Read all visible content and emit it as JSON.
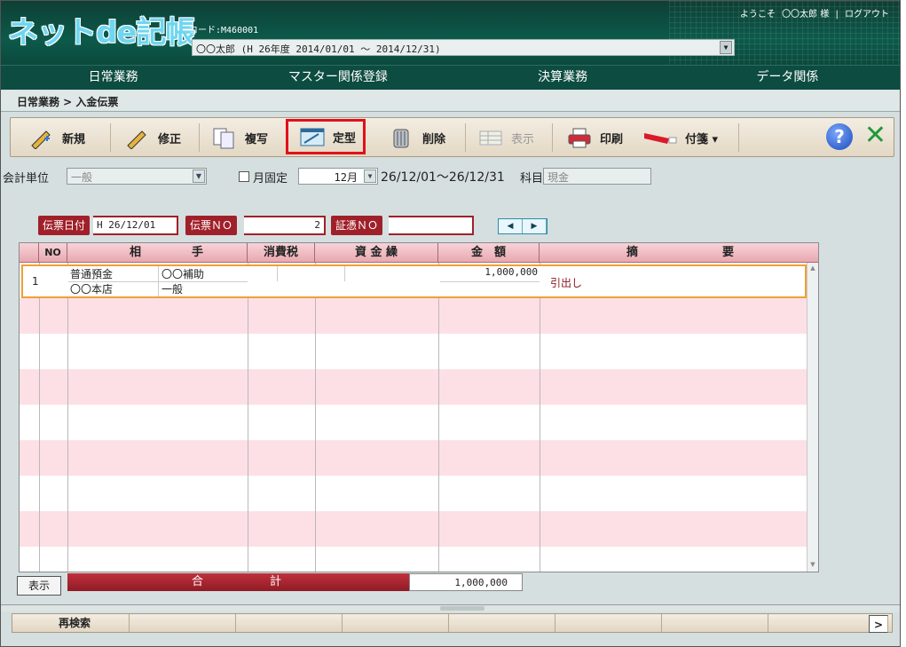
{
  "header": {
    "logo_main": "ネットde記帳",
    "code": "コード:M460001",
    "company": "〇〇太郎 (H 26年度 2014/01/01 ～ 2014/12/31)",
    "welcome": "ようこそ",
    "user": "〇〇太郎 様",
    "separator": "|",
    "logout": "ログアウト"
  },
  "menu": [
    "日常業務",
    "マスター関係登録",
    "決算業務",
    "データ関係"
  ],
  "breadcrumb": "日常業務 > 入金伝票",
  "toolbar": {
    "new": "新規",
    "edit": "修正",
    "copy": "複写",
    "template": "定型",
    "delete": "削除",
    "display": "表示",
    "print": "印刷",
    "sticky": "付箋 ▾",
    "help": "?",
    "close": "✕"
  },
  "filter": {
    "unit_label": "会計単位",
    "unit_value": "一般",
    "month_fixed_label": "月固定",
    "month_value": "12月",
    "date_range": "26/12/01～26/12/31",
    "account_label": "科目",
    "account_value": "現金"
  },
  "voucher": {
    "date_label": "伝票日付",
    "date_value": "H 26/12/01",
    "no_label": "伝票ＮＯ",
    "no_value": "2",
    "proof_label": "証憑ＮＯ",
    "proof_value": ""
  },
  "table": {
    "headers": [
      "NO",
      "相",
      "手",
      "消費税",
      "資 金 繰",
      "金　額",
      "摘",
      "要"
    ],
    "row": {
      "no": "1",
      "account": "普通預金",
      "sub_account": "〇〇補助",
      "department": "〇〇本店",
      "section": "一般",
      "amount": "1,000,000",
      "memo": "引出し"
    }
  },
  "footer": {
    "show_button": "表示",
    "total_label_1": "合",
    "total_label_2": "計",
    "total_value": "1,000,000",
    "research": "再検索",
    "next": ">"
  }
}
